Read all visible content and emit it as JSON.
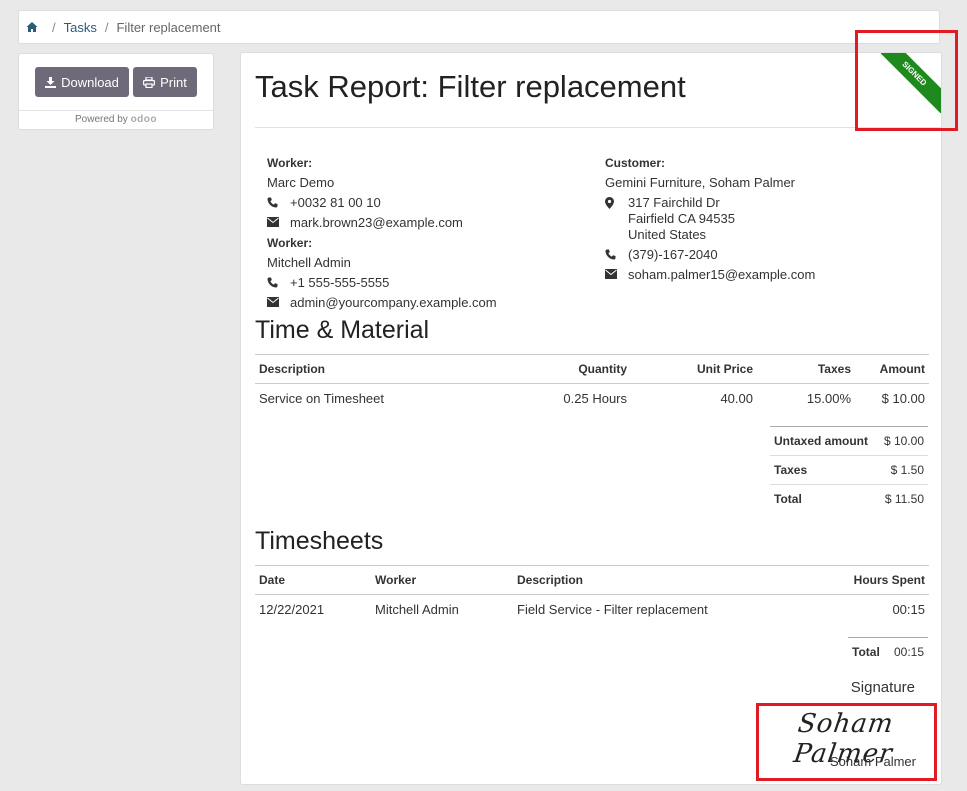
{
  "breadcrumb": {
    "home_icon": "home-icon",
    "items": [
      "Tasks",
      "Filter replacement"
    ]
  },
  "sidebar": {
    "download_label": "Download",
    "print_label": "Print",
    "powered_by": "Powered by",
    "powered_logo": "odoo"
  },
  "report": {
    "ribbon": "SIGNED",
    "title": "Task Report: Filter replacement",
    "workers": [
      {
        "label": "Worker:",
        "name": "Marc Demo",
        "phone": "+0032 81 00 10",
        "email": "mark.brown23@example.com"
      },
      {
        "label": "Worker:",
        "name": "Mitchell Admin",
        "phone": "+1 555-555-5555",
        "email": "admin@yourcompany.example.com"
      }
    ],
    "customer": {
      "label": "Customer:",
      "name": "Gemini Furniture, Soham Palmer",
      "address_line1": "317 Fairchild Dr",
      "address_line2": "Fairfield CA 94535",
      "address_line3": "United States",
      "phone": "(379)-167-2040",
      "email": "soham.palmer15@example.com"
    }
  },
  "time_material": {
    "title": "Time & Material",
    "headers": {
      "description": "Description",
      "quantity": "Quantity",
      "unit_price": "Unit Price",
      "taxes": "Taxes",
      "amount": "Amount"
    },
    "rows": [
      {
        "description": "Service on Timesheet",
        "quantity": "0.25 Hours",
        "unit_price": "40.00",
        "taxes": "15.00%",
        "amount": "$ 10.00"
      }
    ],
    "totals": [
      {
        "label": "Untaxed amount",
        "value": "$ 10.00"
      },
      {
        "label": "Taxes",
        "value": "$ 1.50"
      },
      {
        "label": "Total",
        "value": "$ 11.50"
      }
    ]
  },
  "timesheets": {
    "title": "Timesheets",
    "headers": {
      "date": "Date",
      "worker": "Worker",
      "description": "Description",
      "hours": "Hours Spent"
    },
    "rows": [
      {
        "date": "12/22/2021",
        "worker": "Mitchell Admin",
        "description": "Field Service - Filter replacement",
        "hours": "00:15"
      }
    ],
    "total_label": "Total",
    "total_value": "00:15"
  },
  "signature": {
    "label": "Signature",
    "signature_script": "Soham Palmer",
    "signer_name": "Soham Palmer"
  },
  "colors": {
    "ribbon": "#1e8a1e",
    "button": "#6f6a79",
    "highlight": "#e01b24"
  }
}
